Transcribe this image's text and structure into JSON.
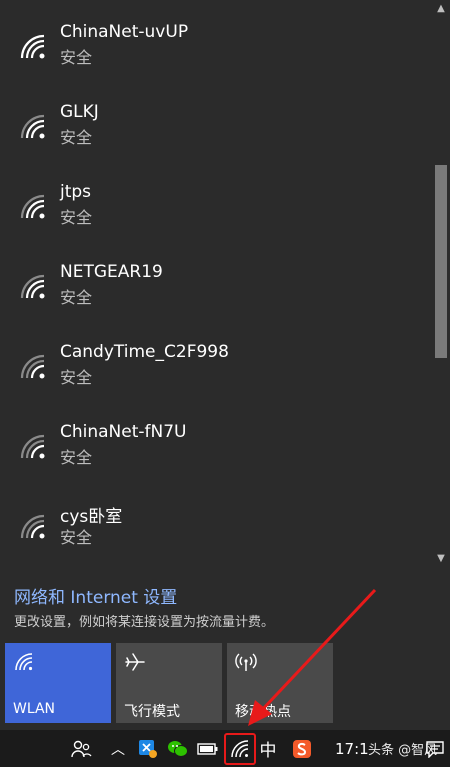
{
  "networks": [
    {
      "ssid": "ChinaNet-uvUP",
      "security": "安全"
    },
    {
      "ssid": "GLKJ",
      "security": "安全"
    },
    {
      "ssid": "jtps",
      "security": "安全"
    },
    {
      "ssid": "NETGEAR19",
      "security": "安全"
    },
    {
      "ssid": "CandyTime_C2F998",
      "security": "安全"
    },
    {
      "ssid": "ChinaNet-fN7U",
      "security": "安全"
    },
    {
      "ssid": "cys卧室",
      "security": "安全"
    }
  ],
  "settings": {
    "link": "网络和 Internet 设置",
    "description": "更改设置，例如将某连接设置为按流量计费。"
  },
  "tiles": {
    "wlan": "WLAN",
    "airplane": "飞行模式",
    "hotspot": "移动热点"
  },
  "taskbar": {
    "ime": "中",
    "clock": "17:1",
    "watermark": "头条 @智风"
  },
  "colors": {
    "accent": "#3f66d8",
    "link": "#8fb8ff",
    "highlight_box": "#e81a1a"
  }
}
